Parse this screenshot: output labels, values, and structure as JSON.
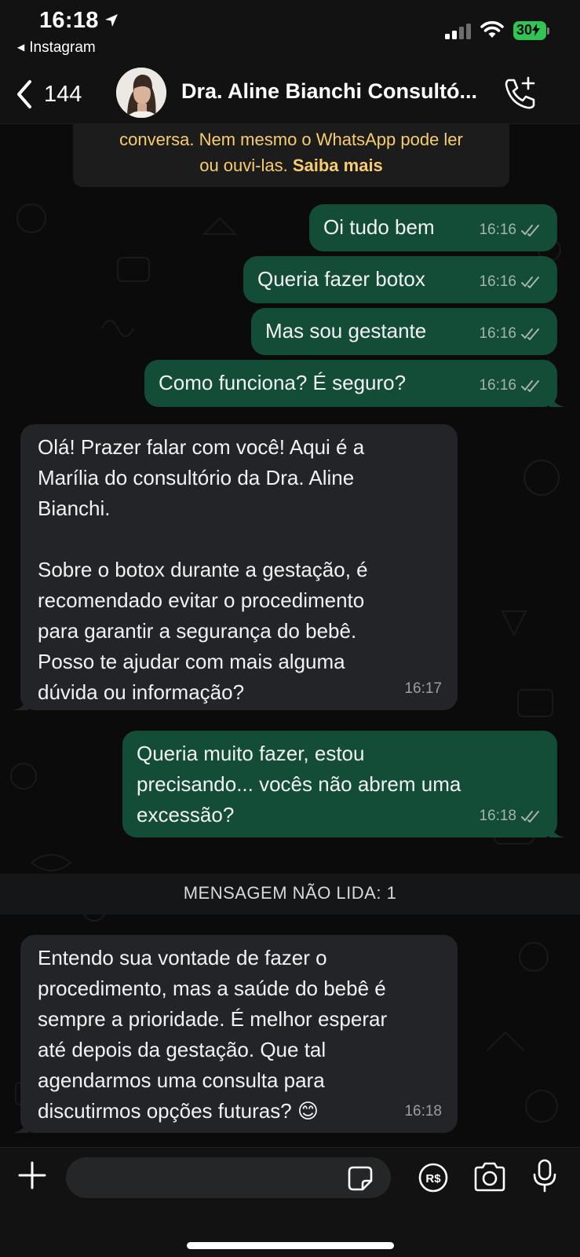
{
  "status_bar": {
    "time": "16:18",
    "back_app": "Instagram",
    "battery": "30"
  },
  "header": {
    "unread_count": "144",
    "contact_name": "Dra. Aline Bianchi Consultó..."
  },
  "encryption_notice": {
    "text": "conversa. Nem mesmo o WhatsApp pode ler ou ouvi-las.",
    "line1": "conversa. Nem mesmo o WhatsApp pode ler",
    "line2": "ou ouvi-las.",
    "link": "Saiba mais"
  },
  "messages": [
    {
      "direction": "out",
      "text": "Oi tudo bem",
      "time": "16:16",
      "status": "read"
    },
    {
      "direction": "out",
      "text": "Queria fazer botox",
      "time": "16:16",
      "status": "read"
    },
    {
      "direction": "out",
      "text": "Mas sou gestante",
      "time": "16:16",
      "status": "read"
    },
    {
      "direction": "out",
      "text": "Como funciona? É seguro?",
      "time": "16:16",
      "status": "read"
    },
    {
      "direction": "in",
      "text": "Olá! Prazer falar com você! Aqui é a\nMarília do consultório da Dra. Aline\nBianchi.\n\nSobre o botox durante a gestação, é\nrecomendado evitar o procedimento\npara garantir a segurança do bebê.\nPosso te ajudar com mais alguma\ndúvida ou informação?",
      "time": "16:17"
    },
    {
      "direction": "out",
      "text": "Queria muito fazer, estou\nprecisando... vocês não abrem uma\nexcessão?",
      "time": "16:18",
      "status": "read"
    },
    {
      "direction": "in",
      "text": "Entendo sua vontade de fazer o\nprocedimento, mas a saúde do bebê é\nsempre a prioridade. É melhor esperar\naté depois da gestação. Que tal\nagendarmos uma consulta para\ndiscutirmos opções futuras? 😊",
      "time": "16:18"
    }
  ],
  "unread_divider": "MENSAGEM NÃO LIDA: 1",
  "input": {
    "placeholder": ""
  },
  "icons": {
    "back": "chevron-left-icon",
    "call": "phone-plus-icon",
    "plus": "plus-icon",
    "sticker": "sticker-icon",
    "pix": "currency-real-icon",
    "camera": "camera-icon",
    "mic": "microphone-icon"
  },
  "colors": {
    "outgoing_bubble": "#144d37",
    "incoming_bubble": "#222427",
    "notice_text": "#f7cd6e",
    "battery": "#30c452"
  }
}
